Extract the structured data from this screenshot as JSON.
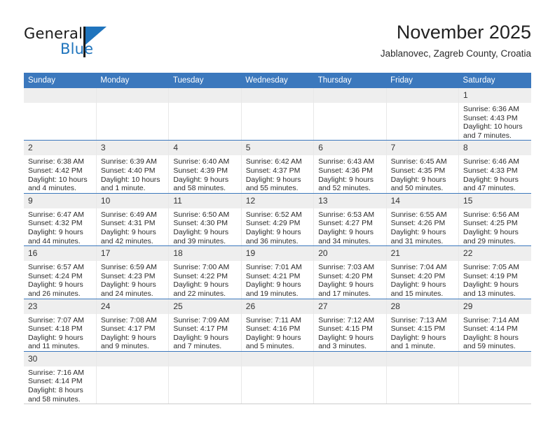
{
  "brand": {
    "name_top": "General",
    "name_bottom": "Blue",
    "accent_color": "#1f74bd",
    "logo_icon": "blue-triangle-icon"
  },
  "header": {
    "title": "November 2025",
    "subtitle": "Jablanovec, Zagreb County, Croatia"
  },
  "theme": {
    "header_blue": "#3b78bd",
    "daynum_bg": "#eeeeee",
    "row_divider": "#3b78bd",
    "cell_divider": "#e8e8e8"
  },
  "calendar": {
    "weekday_headers": [
      "Sunday",
      "Monday",
      "Tuesday",
      "Wednesday",
      "Thursday",
      "Friday",
      "Saturday"
    ],
    "labels": {
      "sunrise": "Sunrise:",
      "sunset": "Sunset:",
      "daylight": "Daylight:"
    },
    "weeks": [
      [
        {
          "day": "",
          "empty": true
        },
        {
          "day": "",
          "empty": true
        },
        {
          "day": "",
          "empty": true
        },
        {
          "day": "",
          "empty": true
        },
        {
          "day": "",
          "empty": true
        },
        {
          "day": "",
          "empty": true
        },
        {
          "day": "1",
          "sunrise": "Sunrise: 6:36 AM",
          "sunset": "Sunset: 4:43 PM",
          "daylight": "Daylight: 10 hours and 7 minutes."
        }
      ],
      [
        {
          "day": "2",
          "sunrise": "Sunrise: 6:38 AM",
          "sunset": "Sunset: 4:42 PM",
          "daylight": "Daylight: 10 hours and 4 minutes."
        },
        {
          "day": "3",
          "sunrise": "Sunrise: 6:39 AM",
          "sunset": "Sunset: 4:40 PM",
          "daylight": "Daylight: 10 hours and 1 minute."
        },
        {
          "day": "4",
          "sunrise": "Sunrise: 6:40 AM",
          "sunset": "Sunset: 4:39 PM",
          "daylight": "Daylight: 9 hours and 58 minutes."
        },
        {
          "day": "5",
          "sunrise": "Sunrise: 6:42 AM",
          "sunset": "Sunset: 4:37 PM",
          "daylight": "Daylight: 9 hours and 55 minutes."
        },
        {
          "day": "6",
          "sunrise": "Sunrise: 6:43 AM",
          "sunset": "Sunset: 4:36 PM",
          "daylight": "Daylight: 9 hours and 52 minutes."
        },
        {
          "day": "7",
          "sunrise": "Sunrise: 6:45 AM",
          "sunset": "Sunset: 4:35 PM",
          "daylight": "Daylight: 9 hours and 50 minutes."
        },
        {
          "day": "8",
          "sunrise": "Sunrise: 6:46 AM",
          "sunset": "Sunset: 4:33 PM",
          "daylight": "Daylight: 9 hours and 47 minutes."
        }
      ],
      [
        {
          "day": "9",
          "sunrise": "Sunrise: 6:47 AM",
          "sunset": "Sunset: 4:32 PM",
          "daylight": "Daylight: 9 hours and 44 minutes."
        },
        {
          "day": "10",
          "sunrise": "Sunrise: 6:49 AM",
          "sunset": "Sunset: 4:31 PM",
          "daylight": "Daylight: 9 hours and 42 minutes."
        },
        {
          "day": "11",
          "sunrise": "Sunrise: 6:50 AM",
          "sunset": "Sunset: 4:30 PM",
          "daylight": "Daylight: 9 hours and 39 minutes."
        },
        {
          "day": "12",
          "sunrise": "Sunrise: 6:52 AM",
          "sunset": "Sunset: 4:29 PM",
          "daylight": "Daylight: 9 hours and 36 minutes."
        },
        {
          "day": "13",
          "sunrise": "Sunrise: 6:53 AM",
          "sunset": "Sunset: 4:27 PM",
          "daylight": "Daylight: 9 hours and 34 minutes."
        },
        {
          "day": "14",
          "sunrise": "Sunrise: 6:55 AM",
          "sunset": "Sunset: 4:26 PM",
          "daylight": "Daylight: 9 hours and 31 minutes."
        },
        {
          "day": "15",
          "sunrise": "Sunrise: 6:56 AM",
          "sunset": "Sunset: 4:25 PM",
          "daylight": "Daylight: 9 hours and 29 minutes."
        }
      ],
      [
        {
          "day": "16",
          "sunrise": "Sunrise: 6:57 AM",
          "sunset": "Sunset: 4:24 PM",
          "daylight": "Daylight: 9 hours and 26 minutes."
        },
        {
          "day": "17",
          "sunrise": "Sunrise: 6:59 AM",
          "sunset": "Sunset: 4:23 PM",
          "daylight": "Daylight: 9 hours and 24 minutes."
        },
        {
          "day": "18",
          "sunrise": "Sunrise: 7:00 AM",
          "sunset": "Sunset: 4:22 PM",
          "daylight": "Daylight: 9 hours and 22 minutes."
        },
        {
          "day": "19",
          "sunrise": "Sunrise: 7:01 AM",
          "sunset": "Sunset: 4:21 PM",
          "daylight": "Daylight: 9 hours and 19 minutes."
        },
        {
          "day": "20",
          "sunrise": "Sunrise: 7:03 AM",
          "sunset": "Sunset: 4:20 PM",
          "daylight": "Daylight: 9 hours and 17 minutes."
        },
        {
          "day": "21",
          "sunrise": "Sunrise: 7:04 AM",
          "sunset": "Sunset: 4:20 PM",
          "daylight": "Daylight: 9 hours and 15 minutes."
        },
        {
          "day": "22",
          "sunrise": "Sunrise: 7:05 AM",
          "sunset": "Sunset: 4:19 PM",
          "daylight": "Daylight: 9 hours and 13 minutes."
        }
      ],
      [
        {
          "day": "23",
          "sunrise": "Sunrise: 7:07 AM",
          "sunset": "Sunset: 4:18 PM",
          "daylight": "Daylight: 9 hours and 11 minutes."
        },
        {
          "day": "24",
          "sunrise": "Sunrise: 7:08 AM",
          "sunset": "Sunset: 4:17 PM",
          "daylight": "Daylight: 9 hours and 9 minutes."
        },
        {
          "day": "25",
          "sunrise": "Sunrise: 7:09 AM",
          "sunset": "Sunset: 4:17 PM",
          "daylight": "Daylight: 9 hours and 7 minutes."
        },
        {
          "day": "26",
          "sunrise": "Sunrise: 7:11 AM",
          "sunset": "Sunset: 4:16 PM",
          "daylight": "Daylight: 9 hours and 5 minutes."
        },
        {
          "day": "27",
          "sunrise": "Sunrise: 7:12 AM",
          "sunset": "Sunset: 4:15 PM",
          "daylight": "Daylight: 9 hours and 3 minutes."
        },
        {
          "day": "28",
          "sunrise": "Sunrise: 7:13 AM",
          "sunset": "Sunset: 4:15 PM",
          "daylight": "Daylight: 9 hours and 1 minute."
        },
        {
          "day": "29",
          "sunrise": "Sunrise: 7:14 AM",
          "sunset": "Sunset: 4:14 PM",
          "daylight": "Daylight: 8 hours and 59 minutes."
        }
      ],
      [
        {
          "day": "30",
          "sunrise": "Sunrise: 7:16 AM",
          "sunset": "Sunset: 4:14 PM",
          "daylight": "Daylight: 8 hours and 58 minutes."
        },
        {
          "day": "",
          "empty": true
        },
        {
          "day": "",
          "empty": true
        },
        {
          "day": "",
          "empty": true
        },
        {
          "day": "",
          "empty": true
        },
        {
          "day": "",
          "empty": true
        },
        {
          "day": "",
          "empty": true
        }
      ]
    ]
  }
}
